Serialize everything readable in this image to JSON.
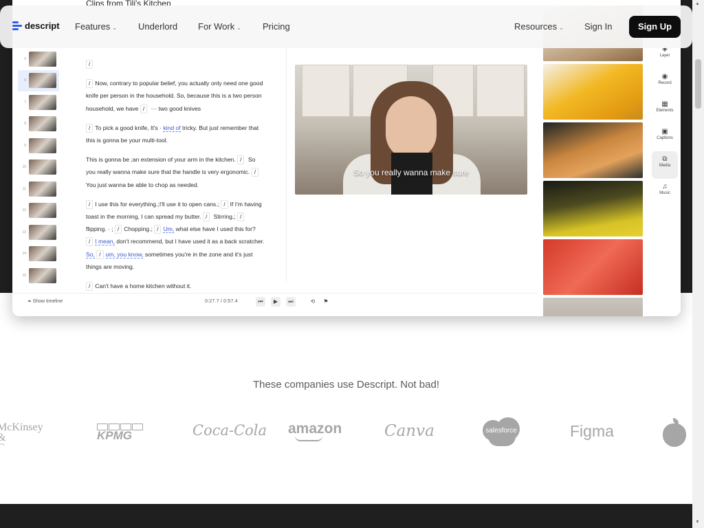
{
  "app_preview": {
    "clip_title": "Clips from Tili's Kitchen",
    "thumbnail_numbers": [
      "5",
      "6",
      "7",
      "8",
      "9",
      "10",
      "11",
      "12",
      "13",
      "14",
      "15"
    ],
    "transcript": [
      [
        {
          "t": "slash",
          "v": "/"
        }
      ],
      [
        {
          "t": "slash",
          "v": "/"
        },
        {
          "t": "text",
          "v": "Now, contrary to popular belief, you actually only need one good knife per person in the household. So, because this is a two person household, we have "
        },
        {
          "t": "slash",
          "v": "/"
        },
        {
          "t": "text",
          "v": " ··· two good knives"
        }
      ],
      [
        {
          "t": "slash",
          "v": "/"
        },
        {
          "t": "text",
          "v": "To pick a good knife, It's · "
        },
        {
          "t": "filler",
          "v": "kind of"
        },
        {
          "t": "text",
          "v": " tricky. But just remember that this is gonna be your multi-tool."
        }
      ],
      [
        {
          "t": "text",
          "v": "This is gonna be ;an extension of your arm in the kitchen. "
        },
        {
          "t": "slash",
          "v": "/"
        },
        {
          "t": "text",
          "v": " So you really wanna make sure that the handle is very ergonomic. "
        },
        {
          "t": "slash",
          "v": "/"
        },
        {
          "t": "text",
          "v": "You just wanna be able to chop as needed."
        }
      ],
      [
        {
          "t": "slash",
          "v": "/"
        },
        {
          "t": "text",
          "v": "I use this for everything.;I'll use it to open cans.; "
        },
        {
          "t": "slash",
          "v": "/"
        },
        {
          "t": "text",
          "v": "If I'm having toast in the morning, I can spread my butter. "
        },
        {
          "t": "slash",
          "v": "/"
        },
        {
          "t": "text",
          "v": " Stirring,; "
        },
        {
          "t": "slash",
          "v": "/"
        },
        {
          "t": "text",
          "v": "flipping. · ; "
        },
        {
          "t": "slash",
          "v": "/"
        },
        {
          "t": "text",
          "v": "Chopping.; "
        },
        {
          "t": "slash",
          "v": "/"
        },
        {
          "t": "filler",
          "v": "Um,"
        },
        {
          "t": "text",
          "v": " what else have I used this for? "
        },
        {
          "t": "slash",
          "v": "/"
        },
        {
          "t": "filler",
          "v": "I mean,"
        },
        {
          "t": "text",
          "v": " don't recommend, but I have used it as a back scratcher. "
        },
        {
          "t": "filler",
          "v": "So,"
        },
        {
          "t": "text",
          "v": " "
        },
        {
          "t": "slash",
          "v": "/"
        },
        {
          "t": "filler",
          "v": "um, you know,"
        },
        {
          "t": "text",
          "v": " sometimes you're in the zone and it's just things are moving."
        }
      ],
      [
        {
          "t": "slash",
          "v": "/"
        },
        {
          "t": "text",
          "v": "Can't have a home kitchen without it."
        }
      ]
    ],
    "video_caption": "So you really wanna make sure",
    "player": {
      "show_timeline": "Show timeline",
      "current_time": "0:27.7",
      "separator": "/",
      "total_time": "0:57.4"
    },
    "tools": [
      {
        "label": "Layer",
        "icon": "layer-icon",
        "glyph": "◈"
      },
      {
        "label": "Record",
        "icon": "record-icon",
        "glyph": "◉"
      },
      {
        "label": "Elements",
        "icon": "elements-icon",
        "glyph": "▦"
      },
      {
        "label": "Captions",
        "icon": "captions-icon",
        "glyph": "▣"
      },
      {
        "label": "Media",
        "icon": "media-icon",
        "glyph": "⧉"
      },
      {
        "label": "Music",
        "icon": "music-icon",
        "glyph": "♫"
      }
    ],
    "active_tool": "Media"
  },
  "navbar": {
    "brand": "descript",
    "features": "Features",
    "underlord": "Underlord",
    "for_work": "For Work",
    "pricing": "Pricing",
    "resources": "Resources",
    "sign_in": "Sign In",
    "sign_up": "Sign Up"
  },
  "companies": {
    "heading": "These companies use Descript. Not bad!",
    "logos": [
      "McKinsey & Company",
      "KPMG",
      "Coca-Cola",
      "amazon",
      "Canva",
      "salesforce",
      "Figma",
      "Apple"
    ]
  },
  "colors": {
    "brand_blue": "#2f5bea",
    "dark_bg": "#1f1f1f",
    "signup_bg": "#0d0d0d",
    "logo_gray": "#a6a6a6"
  }
}
